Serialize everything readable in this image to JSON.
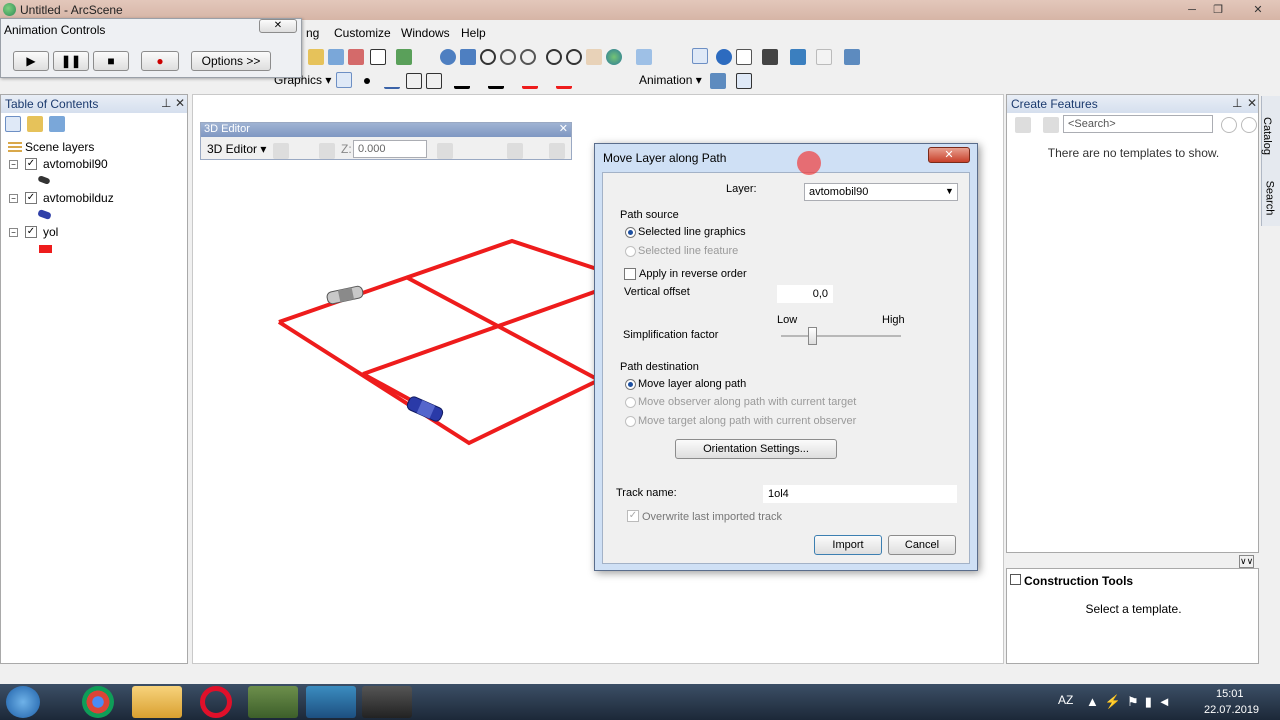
{
  "window": {
    "title": "Untitled - ArcScene"
  },
  "menu": [
    "ng",
    "Customize",
    "Windows",
    "Help"
  ],
  "toolbar2": {
    "graphics_label": "Graphics ▾",
    "animation_label": "Animation ▾"
  },
  "animation_controls": {
    "title": "Animation Controls",
    "options_label": "Options >>"
  },
  "toc": {
    "title": "Table of Contents",
    "root": "Scene layers",
    "layers": [
      {
        "name": "avtomobil90"
      },
      {
        "name": "avtomobilduz"
      },
      {
        "name": "yol"
      }
    ]
  },
  "editor": {
    "title": "3D Editor",
    "menu_label": "3D Editor ▾",
    "z_label": "Z:",
    "z_value": "0.000"
  },
  "create_features": {
    "title": "Create Features",
    "search_placeholder": "<Search>",
    "empty_msg": "There are no templates to show."
  },
  "construction_tools": {
    "title": "Construction Tools",
    "msg": "Select a template."
  },
  "side_tabs": [
    "Catalog",
    "Search"
  ],
  "dialog": {
    "title": "Move Layer along Path",
    "layer_label": "Layer:",
    "layer_value": "avtomobil90",
    "path_source_label": "Path source",
    "selected_line_graphics": "Selected line graphics",
    "selected_line_feature": "Selected line feature",
    "apply_reverse": "Apply in reverse order",
    "vertical_offset_label": "Vertical offset",
    "vertical_offset_value": "0,0",
    "low_label": "Low",
    "high_label": "High",
    "simplification_label": "Simplification factor",
    "path_dest_label": "Path destination",
    "move_layer": "Move layer along path",
    "move_observer": "Move observer along path with current target",
    "move_target": "Move target along path with current observer",
    "orientation_btn": "Orientation Settings...",
    "track_name_label": "Track name:",
    "track_name_value": "1ol4",
    "overwrite_label": "Overwrite last imported track",
    "import_btn": "Import",
    "cancel_btn": "Cancel"
  },
  "taskbar": {
    "lang": "AZ",
    "time": "15:01",
    "date": "22.07.2019"
  },
  "colors": {
    "road": "#ee1c1c",
    "pane_header": "#d5dfee",
    "dialog_frame": "#cfe0f5"
  }
}
